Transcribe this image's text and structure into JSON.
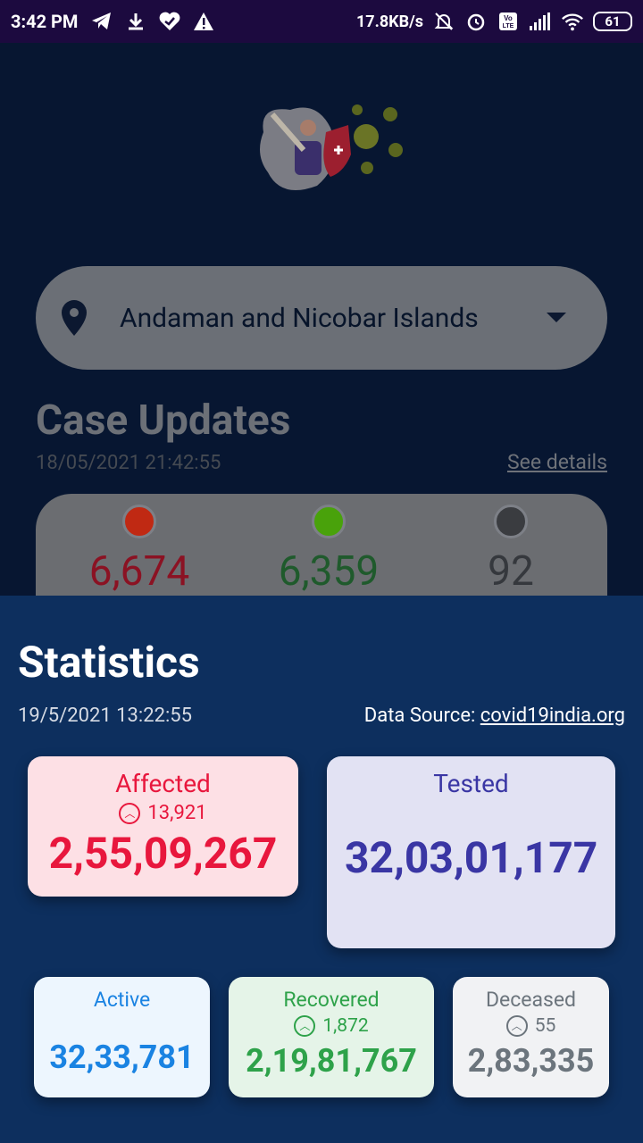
{
  "status_bar": {
    "time": "3:42 PM",
    "net_speed": "17.8KB/s",
    "battery": "61"
  },
  "location": {
    "selected": "Andaman and Nicobar Islands"
  },
  "case_updates": {
    "title": "Case Updates",
    "date": "18/05/2021 21:42:55",
    "see_details": "See details",
    "confirmed": "6,674",
    "recovered": "6,359",
    "deceased": "92",
    "colors": {
      "confirmed": "#c02913",
      "recovered": "#49a20b",
      "deceased": "#3a3c40"
    }
  },
  "statistics": {
    "title": "Statistics",
    "date": "19/5/2021 13:22:55",
    "source_label": "Data Source: ",
    "source_link": "covid19india.org",
    "affected": {
      "label": "Affected",
      "delta": "13,921",
      "value": "2,55,09,267"
    },
    "tested": {
      "label": "Tested",
      "value": "32,03,01,177"
    },
    "active": {
      "label": "Active",
      "value": "32,33,781"
    },
    "recovered": {
      "label": "Recovered",
      "delta": "1,872",
      "value": "2,19,81,767"
    },
    "deceased": {
      "label": "Deceased",
      "delta": "55",
      "value": "2,83,335"
    }
  }
}
